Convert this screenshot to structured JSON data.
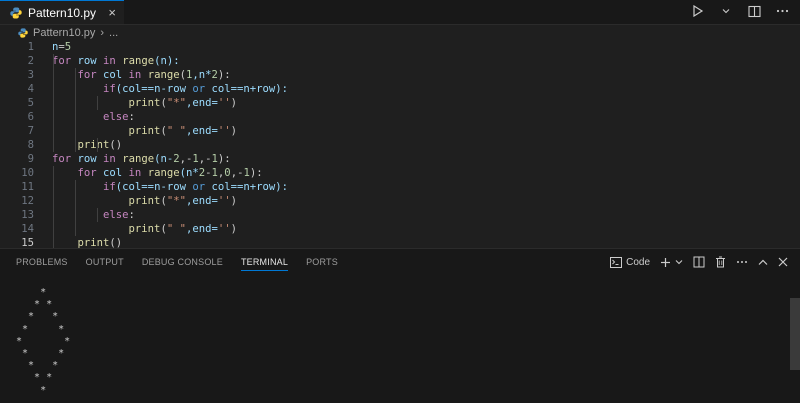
{
  "tab": {
    "filename": "Pattern10.py",
    "close": "×"
  },
  "breadcrumb": {
    "file": "Pattern10.py",
    "sep": "›",
    "more": "..."
  },
  "editor": {
    "lines": [
      {
        "n": "1",
        "tokens": [
          {
            "t": "n",
            "c": "var"
          },
          {
            "t": "=",
            "c": ""
          },
          {
            "t": "5",
            "c": "num"
          }
        ]
      },
      {
        "n": "2",
        "tokens": [
          {
            "t": "for",
            "c": "kw"
          },
          {
            "t": " row ",
            "c": "var"
          },
          {
            "t": "in",
            "c": "kw"
          },
          {
            "t": " ",
            "c": ""
          },
          {
            "t": "range",
            "c": "fn"
          },
          {
            "t": "(n):",
            "c": "var"
          }
        ]
      },
      {
        "n": "3",
        "tokens": [
          {
            "t": "    ",
            "c": ""
          },
          {
            "t": "for",
            "c": "kw"
          },
          {
            "t": " col ",
            "c": "var"
          },
          {
            "t": "in",
            "c": "kw"
          },
          {
            "t": " ",
            "c": ""
          },
          {
            "t": "range",
            "c": "fn"
          },
          {
            "t": "(",
            "c": ""
          },
          {
            "t": "1",
            "c": "num"
          },
          {
            "t": ",n*",
            "c": "var"
          },
          {
            "t": "2",
            "c": "num"
          },
          {
            "t": "):",
            "c": ""
          }
        ]
      },
      {
        "n": "4",
        "tokens": [
          {
            "t": "        ",
            "c": ""
          },
          {
            "t": "if",
            "c": "kw"
          },
          {
            "t": "(col==n-row ",
            "c": "var"
          },
          {
            "t": "or",
            "c": "kw2"
          },
          {
            "t": " col==n+row):",
            "c": "var"
          }
        ]
      },
      {
        "n": "5",
        "tokens": [
          {
            "t": "            ",
            "c": ""
          },
          {
            "t": "print",
            "c": "fn"
          },
          {
            "t": "(",
            "c": ""
          },
          {
            "t": "\"*\"",
            "c": "str"
          },
          {
            "t": ",end=",
            "c": "var"
          },
          {
            "t": "''",
            "c": "str"
          },
          {
            "t": ")",
            "c": ""
          }
        ]
      },
      {
        "n": "6",
        "tokens": [
          {
            "t": "        ",
            "c": ""
          },
          {
            "t": "else",
            "c": "kw"
          },
          {
            "t": ":",
            "c": ""
          }
        ]
      },
      {
        "n": "7",
        "tokens": [
          {
            "t": "            ",
            "c": ""
          },
          {
            "t": "print",
            "c": "fn"
          },
          {
            "t": "(",
            "c": ""
          },
          {
            "t": "\" \"",
            "c": "str"
          },
          {
            "t": ",end=",
            "c": "var"
          },
          {
            "t": "''",
            "c": "str"
          },
          {
            "t": ")",
            "c": ""
          }
        ]
      },
      {
        "n": "8",
        "tokens": [
          {
            "t": "    ",
            "c": ""
          },
          {
            "t": "print",
            "c": "fn"
          },
          {
            "t": "()",
            "c": ""
          }
        ]
      },
      {
        "n": "9",
        "tokens": [
          {
            "t": "for",
            "c": "kw"
          },
          {
            "t": " row ",
            "c": "var"
          },
          {
            "t": "in",
            "c": "kw"
          },
          {
            "t": " ",
            "c": ""
          },
          {
            "t": "range",
            "c": "fn"
          },
          {
            "t": "(n-",
            "c": "var"
          },
          {
            "t": "2",
            "c": "num"
          },
          {
            "t": ",-",
            "c": ""
          },
          {
            "t": "1",
            "c": "num"
          },
          {
            "t": ",-",
            "c": ""
          },
          {
            "t": "1",
            "c": "num"
          },
          {
            "t": "):",
            "c": ""
          }
        ]
      },
      {
        "n": "10",
        "tokens": [
          {
            "t": "    ",
            "c": ""
          },
          {
            "t": "for",
            "c": "kw"
          },
          {
            "t": " col ",
            "c": "var"
          },
          {
            "t": "in",
            "c": "kw"
          },
          {
            "t": " ",
            "c": ""
          },
          {
            "t": "range",
            "c": "fn"
          },
          {
            "t": "(n*",
            "c": "var"
          },
          {
            "t": "2",
            "c": "num"
          },
          {
            "t": "-",
            "c": ""
          },
          {
            "t": "1",
            "c": "num"
          },
          {
            "t": ",",
            "c": ""
          },
          {
            "t": "0",
            "c": "num"
          },
          {
            "t": ",-",
            "c": ""
          },
          {
            "t": "1",
            "c": "num"
          },
          {
            "t": "):",
            "c": ""
          }
        ]
      },
      {
        "n": "11",
        "tokens": [
          {
            "t": "        ",
            "c": ""
          },
          {
            "t": "if",
            "c": "kw"
          },
          {
            "t": "(col==n-row ",
            "c": "var"
          },
          {
            "t": "or",
            "c": "kw2"
          },
          {
            "t": " col==n+row):",
            "c": "var"
          }
        ]
      },
      {
        "n": "12",
        "tokens": [
          {
            "t": "            ",
            "c": ""
          },
          {
            "t": "print",
            "c": "fn"
          },
          {
            "t": "(",
            "c": ""
          },
          {
            "t": "\"*\"",
            "c": "str"
          },
          {
            "t": ",end=",
            "c": "var"
          },
          {
            "t": "''",
            "c": "str"
          },
          {
            "t": ")",
            "c": ""
          }
        ]
      },
      {
        "n": "13",
        "tokens": [
          {
            "t": "        ",
            "c": ""
          },
          {
            "t": "else",
            "c": "kw"
          },
          {
            "t": ":",
            "c": ""
          }
        ]
      },
      {
        "n": "14",
        "tokens": [
          {
            "t": "            ",
            "c": ""
          },
          {
            "t": "print",
            "c": "fn"
          },
          {
            "t": "(",
            "c": ""
          },
          {
            "t": "\" \"",
            "c": "str"
          },
          {
            "t": ",end=",
            "c": "var"
          },
          {
            "t": "''",
            "c": "str"
          },
          {
            "t": ")",
            "c": ""
          }
        ]
      },
      {
        "n": "15",
        "tokens": [
          {
            "t": "    ",
            "c": ""
          },
          {
            "t": "print",
            "c": "fn"
          },
          {
            "t": "()",
            "c": ""
          }
        ]
      }
    ],
    "active_line": "15"
  },
  "panel": {
    "tabs": [
      "PROBLEMS",
      "OUTPUT",
      "DEBUG CONSOLE",
      "TERMINAL",
      "PORTS"
    ],
    "active_tab": "TERMINAL",
    "terminal_label": "Code",
    "output": "    *\n   * *\n  *   *\n *     *\n*       *\n *     *\n  *   *\n   * *\n    *"
  },
  "colors": {
    "accent": "#0078d4",
    "background": "#1f1f1f",
    "panel": "#181818"
  }
}
